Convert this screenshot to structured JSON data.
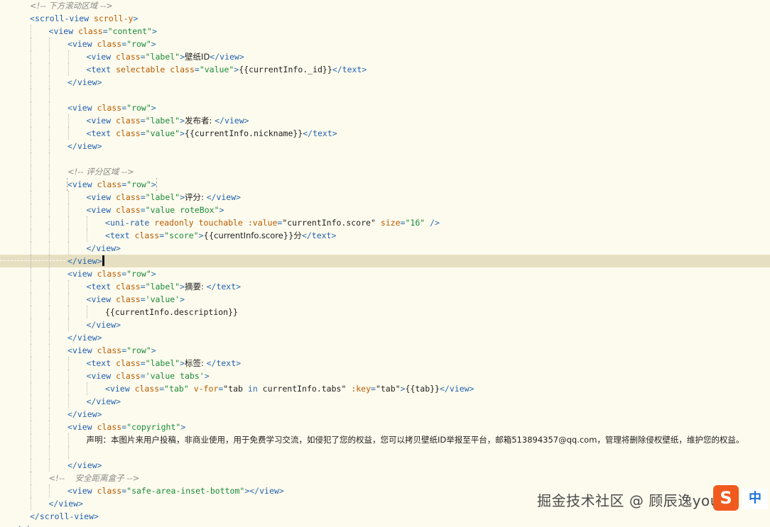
{
  "colors": {
    "background": "#fdfbed",
    "current_line": "#e6dfc1",
    "tag": "#1f5fb0",
    "attribute": "#b85a00",
    "string": "#1a8a3a",
    "comment": "#8a8a8a",
    "text": "#222222"
  },
  "editor": {
    "lines": [
      {
        "indent": 1,
        "tokens": [
          [
            "c",
            "<!-- 下方滚动区域 -->"
          ]
        ]
      },
      {
        "indent": 1,
        "tokens": [
          [
            "p",
            "<"
          ],
          [
            "t",
            "scroll-view"
          ],
          [
            "x",
            " "
          ],
          [
            "a",
            "scroll-y"
          ],
          [
            "p",
            ">"
          ]
        ]
      },
      {
        "indent": 2,
        "tokens": [
          [
            "p",
            "<"
          ],
          [
            "t",
            "view"
          ],
          [
            "x",
            " "
          ],
          [
            "a",
            "class"
          ],
          [
            "p",
            "="
          ],
          [
            "s",
            "\"content\""
          ],
          [
            "p",
            ">"
          ]
        ]
      },
      {
        "indent": 3,
        "tokens": [
          [
            "p",
            "<"
          ],
          [
            "t",
            "view"
          ],
          [
            "x",
            " "
          ],
          [
            "a",
            "class"
          ],
          [
            "p",
            "="
          ],
          [
            "s",
            "\"row\""
          ],
          [
            "p",
            ">"
          ]
        ]
      },
      {
        "indent": 4,
        "tokens": [
          [
            "p",
            "<"
          ],
          [
            "t",
            "view"
          ],
          [
            "x",
            " "
          ],
          [
            "a",
            "class"
          ],
          [
            "p",
            "="
          ],
          [
            "s",
            "\"label\""
          ],
          [
            "p",
            ">"
          ],
          [
            "x",
            "壁纸ID"
          ],
          [
            "p",
            "</"
          ],
          [
            "t",
            "view"
          ],
          [
            "p",
            ">"
          ]
        ]
      },
      {
        "indent": 4,
        "tokens": [
          [
            "p",
            "<"
          ],
          [
            "t",
            "text"
          ],
          [
            "x",
            " "
          ],
          [
            "a",
            "selectable"
          ],
          [
            "x",
            " "
          ],
          [
            "a",
            "class"
          ],
          [
            "p",
            "="
          ],
          [
            "s",
            "\"value\""
          ],
          [
            "p",
            ">"
          ],
          [
            "x",
            "{{currentInfo._id}}"
          ],
          [
            "p",
            "</"
          ],
          [
            "t",
            "text"
          ],
          [
            "p",
            ">"
          ]
        ]
      },
      {
        "indent": 3,
        "tokens": [
          [
            "p",
            "</"
          ],
          [
            "t",
            "view"
          ],
          [
            "p",
            ">"
          ]
        ]
      },
      {
        "indent": 3,
        "tokens": []
      },
      {
        "indent": 3,
        "tokens": [
          [
            "p",
            "<"
          ],
          [
            "t",
            "view"
          ],
          [
            "x",
            " "
          ],
          [
            "a",
            "class"
          ],
          [
            "p",
            "="
          ],
          [
            "s",
            "\"row\""
          ],
          [
            "p",
            ">"
          ]
        ]
      },
      {
        "indent": 4,
        "tokens": [
          [
            "p",
            "<"
          ],
          [
            "t",
            "view"
          ],
          [
            "x",
            " "
          ],
          [
            "a",
            "class"
          ],
          [
            "p",
            "="
          ],
          [
            "s",
            "\"label\""
          ],
          [
            "p",
            ">"
          ],
          [
            "x",
            "发布者: "
          ],
          [
            "p",
            "</"
          ],
          [
            "t",
            "view"
          ],
          [
            "p",
            ">"
          ]
        ]
      },
      {
        "indent": 4,
        "tokens": [
          [
            "p",
            "<"
          ],
          [
            "t",
            "text"
          ],
          [
            "x",
            " "
          ],
          [
            "a",
            "class"
          ],
          [
            "p",
            "="
          ],
          [
            "s",
            "\"value\""
          ],
          [
            "p",
            ">"
          ],
          [
            "x",
            "{{currentInfo.nickname}}"
          ],
          [
            "p",
            "</"
          ],
          [
            "t",
            "text"
          ],
          [
            "p",
            ">"
          ]
        ]
      },
      {
        "indent": 3,
        "tokens": [
          [
            "p",
            "</"
          ],
          [
            "t",
            "view"
          ],
          [
            "p",
            ">"
          ]
        ]
      },
      {
        "indent": 3,
        "tokens": []
      },
      {
        "indent": 3,
        "tokens": [
          [
            "c",
            "<!-- 评分区域 -->"
          ]
        ]
      },
      {
        "indent": 3,
        "matched": true,
        "tokens": [
          [
            "p",
            "<"
          ],
          [
            "t",
            "view"
          ],
          [
            "x",
            " "
          ],
          [
            "a",
            "class"
          ],
          [
            "p",
            "="
          ],
          [
            "s",
            "\"row\""
          ],
          [
            "p",
            ">"
          ]
        ]
      },
      {
        "indent": 4,
        "tokens": [
          [
            "p",
            "<"
          ],
          [
            "t",
            "view"
          ],
          [
            "x",
            " "
          ],
          [
            "a",
            "class"
          ],
          [
            "p",
            "="
          ],
          [
            "s",
            "\"label\""
          ],
          [
            "p",
            ">"
          ],
          [
            "x",
            "评分: "
          ],
          [
            "p",
            "</"
          ],
          [
            "t",
            "view"
          ],
          [
            "p",
            ">"
          ]
        ]
      },
      {
        "indent": 4,
        "tokens": [
          [
            "p",
            "<"
          ],
          [
            "t",
            "view"
          ],
          [
            "x",
            " "
          ],
          [
            "a",
            "class"
          ],
          [
            "p",
            "="
          ],
          [
            "s",
            "\"value roteBox\""
          ],
          [
            "p",
            ">"
          ]
        ]
      },
      {
        "indent": 5,
        "tokens": [
          [
            "p",
            "<"
          ],
          [
            "t",
            "uni-rate"
          ],
          [
            "x",
            " "
          ],
          [
            "a",
            "readonly"
          ],
          [
            "x",
            " "
          ],
          [
            "a",
            "touchable"
          ],
          [
            "x",
            " "
          ],
          [
            "a",
            ":value"
          ],
          [
            "p",
            "="
          ],
          [
            "x",
            "\"currentInfo.score\""
          ],
          [
            "x",
            " "
          ],
          [
            "a",
            "size"
          ],
          [
            "p",
            "="
          ],
          [
            "s",
            "\"16\""
          ],
          [
            "x",
            " "
          ],
          [
            "p",
            "/>"
          ]
        ]
      },
      {
        "indent": 5,
        "tokens": [
          [
            "p",
            "<"
          ],
          [
            "t",
            "text"
          ],
          [
            "x",
            " "
          ],
          [
            "a",
            "class"
          ],
          [
            "p",
            "="
          ],
          [
            "s",
            "\"score\""
          ],
          [
            "p",
            ">"
          ],
          [
            "x",
            "{{currentInfo.score}}分"
          ],
          [
            "p",
            "</"
          ],
          [
            "t",
            "text"
          ],
          [
            "p",
            ">"
          ]
        ]
      },
      {
        "indent": 4,
        "tokens": [
          [
            "p",
            "</"
          ],
          [
            "t",
            "view"
          ],
          [
            "p",
            ">"
          ]
        ]
      },
      {
        "indent": 3,
        "current": true,
        "cursor": true,
        "tokens": [
          [
            "p",
            "</"
          ],
          [
            "t",
            "view"
          ],
          [
            "p",
            ">"
          ]
        ]
      },
      {
        "indent": 3,
        "tokens": [
          [
            "p",
            "<"
          ],
          [
            "t",
            "view"
          ],
          [
            "x",
            " "
          ],
          [
            "a",
            "class"
          ],
          [
            "p",
            "="
          ],
          [
            "s",
            "\"row\""
          ],
          [
            "p",
            ">"
          ]
        ]
      },
      {
        "indent": 4,
        "tokens": [
          [
            "p",
            "<"
          ],
          [
            "t",
            "text"
          ],
          [
            "x",
            " "
          ],
          [
            "a",
            "class"
          ],
          [
            "p",
            "="
          ],
          [
            "s",
            "\"label\""
          ],
          [
            "p",
            ">"
          ],
          [
            "x",
            "摘要: "
          ],
          [
            "p",
            "</"
          ],
          [
            "t",
            "text"
          ],
          [
            "p",
            ">"
          ]
        ]
      },
      {
        "indent": 4,
        "tokens": [
          [
            "p",
            "<"
          ],
          [
            "t",
            "view"
          ],
          [
            "x",
            " "
          ],
          [
            "a",
            "class"
          ],
          [
            "p",
            "="
          ],
          [
            "s",
            "'value'"
          ],
          [
            "p",
            ">"
          ]
        ]
      },
      {
        "indent": 5,
        "tokens": [
          [
            "x",
            "{{currentInfo.description}}"
          ]
        ]
      },
      {
        "indent": 4,
        "tokens": [
          [
            "p",
            "</"
          ],
          [
            "t",
            "view"
          ],
          [
            "p",
            ">"
          ]
        ]
      },
      {
        "indent": 3,
        "tokens": [
          [
            "p",
            "</"
          ],
          [
            "t",
            "view"
          ],
          [
            "p",
            ">"
          ]
        ]
      },
      {
        "indent": 3,
        "tokens": [
          [
            "p",
            "<"
          ],
          [
            "t",
            "view"
          ],
          [
            "x",
            " "
          ],
          [
            "a",
            "class"
          ],
          [
            "p",
            "="
          ],
          [
            "s",
            "\"row\""
          ],
          [
            "p",
            ">"
          ]
        ]
      },
      {
        "indent": 4,
        "tokens": [
          [
            "p",
            "<"
          ],
          [
            "t",
            "text"
          ],
          [
            "x",
            " "
          ],
          [
            "a",
            "class"
          ],
          [
            "p",
            "="
          ],
          [
            "s",
            "\"label\""
          ],
          [
            "p",
            ">"
          ],
          [
            "x",
            "标签: "
          ],
          [
            "p",
            "</"
          ],
          [
            "t",
            "text"
          ],
          [
            "p",
            ">"
          ]
        ]
      },
      {
        "indent": 4,
        "tokens": [
          [
            "p",
            "<"
          ],
          [
            "t",
            "view"
          ],
          [
            "x",
            " "
          ],
          [
            "a",
            "class"
          ],
          [
            "p",
            "="
          ],
          [
            "s",
            "'value tabs'"
          ],
          [
            "p",
            ">"
          ]
        ]
      },
      {
        "indent": 5,
        "tokens": [
          [
            "p",
            "<"
          ],
          [
            "t",
            "view"
          ],
          [
            "x",
            " "
          ],
          [
            "a",
            "class"
          ],
          [
            "p",
            "="
          ],
          [
            "s",
            "\"tab\""
          ],
          [
            "x",
            " "
          ],
          [
            "a",
            "v-for"
          ],
          [
            "p",
            "="
          ],
          [
            "x",
            "\"tab "
          ],
          [
            "k",
            "in"
          ],
          [
            "x",
            " currentInfo.tabs\""
          ],
          [
            "x",
            " "
          ],
          [
            "a",
            ":key"
          ],
          [
            "p",
            "="
          ],
          [
            "x",
            "\"tab\""
          ],
          [
            "p",
            ">"
          ],
          [
            "x",
            "{{tab}}"
          ],
          [
            "p",
            "</"
          ],
          [
            "t",
            "view"
          ],
          [
            "p",
            ">"
          ]
        ]
      },
      {
        "indent": 4,
        "tokens": [
          [
            "p",
            "</"
          ],
          [
            "t",
            "view"
          ],
          [
            "p",
            ">"
          ]
        ]
      },
      {
        "indent": 3,
        "tokens": [
          [
            "p",
            "</"
          ],
          [
            "t",
            "view"
          ],
          [
            "p",
            ">"
          ]
        ]
      },
      {
        "indent": 3,
        "tokens": [
          [
            "p",
            "<"
          ],
          [
            "t",
            "view"
          ],
          [
            "x",
            " "
          ],
          [
            "a",
            "class"
          ],
          [
            "p",
            "="
          ],
          [
            "s",
            "\"copyright\""
          ],
          [
            "p",
            ">"
          ]
        ]
      },
      {
        "indent": 4,
        "tokens": [
          [
            "x",
            "声明：本图片来用户投稿，非商业使用，用于免费学习交流，如侵犯了您的权益，您可以拷贝壁纸ID举报至平台，邮箱513894357@qq.com，管理将删除侵权壁纸，维护您的权益。"
          ]
        ]
      },
      {
        "indent": 4,
        "tokens": []
      },
      {
        "indent": 3,
        "tokens": [
          [
            "p",
            "</"
          ],
          [
            "t",
            "view"
          ],
          [
            "p",
            ">"
          ]
        ]
      },
      {
        "indent": 2,
        "tokens": [
          [
            "c",
            "<!--    安全距离盒子 -->"
          ]
        ]
      },
      {
        "indent": 3,
        "tokens": [
          [
            "p",
            "<"
          ],
          [
            "t",
            "view"
          ],
          [
            "x",
            " "
          ],
          [
            "a",
            "class"
          ],
          [
            "p",
            "="
          ],
          [
            "s",
            "\"safe-area-inset-bottom\""
          ],
          [
            "p",
            ">"
          ],
          [
            "p",
            "</"
          ],
          [
            "t",
            "view"
          ],
          [
            "p",
            ">"
          ]
        ]
      },
      {
        "indent": 2,
        "tokens": [
          [
            "p",
            "</"
          ],
          [
            "t",
            "view"
          ],
          [
            "p",
            ">"
          ]
        ]
      },
      {
        "indent": 1,
        "tokens": [
          [
            "p",
            "</"
          ],
          [
            "t",
            "scroll-view"
          ],
          [
            "p",
            ">"
          ]
        ]
      },
      {
        "indent": 0,
        "tokens": [
          [
            "p",
            "</"
          ],
          [
            "t",
            "view"
          ],
          [
            "p",
            ">"
          ]
        ]
      }
    ]
  },
  "watermark": {
    "text": "掘金技术社区 @ 顾辰逸you"
  },
  "ime": {
    "logo_icon": "sogou-ime-icon",
    "logo_glyph": "S",
    "mode_label": "中"
  }
}
